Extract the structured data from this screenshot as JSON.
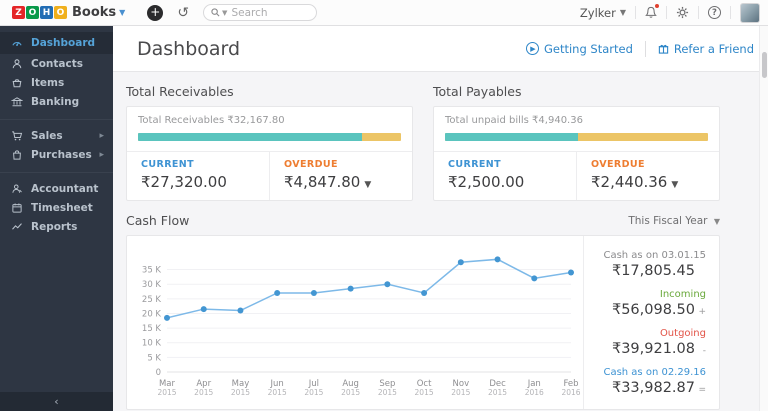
{
  "topbar": {
    "logo_letters": [
      {
        "ch": "Z",
        "color": "#e42527"
      },
      {
        "ch": "O",
        "color": "#089949"
      },
      {
        "ch": "H",
        "color": "#226db4"
      },
      {
        "ch": "O",
        "color": "#f0b01d"
      }
    ],
    "product": "Books",
    "plus_label": "+",
    "history_glyph": "↺",
    "search_placeholder": "Search",
    "org_name": "Zylker"
  },
  "sidebar": {
    "items": [
      {
        "label": "Dashboard"
      },
      {
        "label": "Contacts"
      },
      {
        "label": "Items"
      },
      {
        "label": "Banking"
      },
      {
        "label": "Sales"
      },
      {
        "label": "Purchases"
      },
      {
        "label": "Accountant"
      },
      {
        "label": "Timesheet"
      },
      {
        "label": "Reports"
      }
    ],
    "collapse_glyph": "‹"
  },
  "header": {
    "title": "Dashboard",
    "getting_started": "Getting Started",
    "refer_friend": "Refer a Friend"
  },
  "receivables": {
    "section_title": "Total Receivables",
    "summary": "Total Receivables ₹32,167.80",
    "current_label": "CURRENT",
    "current_value": "₹27,320.00",
    "overdue_label": "OVERDUE",
    "overdue_value": "₹4,847.80",
    "current_pct": 85
  },
  "payables": {
    "section_title": "Total Payables",
    "summary": "Total unpaid bills ₹4,940.36",
    "current_label": "CURRENT",
    "current_value": "₹2,500.00",
    "overdue_label": "OVERDUE",
    "overdue_value": "₹2,440.36",
    "current_pct": 50.6
  },
  "cashflow": {
    "section_title": "Cash Flow",
    "period": "This Fiscal Year",
    "rows": [
      {
        "label": "Cash as on 03.01.15",
        "value": "₹17,805.45",
        "sign": "",
        "color": "#8b8b8d"
      },
      {
        "label": "Incoming",
        "value": "₹56,098.50",
        "sign": "+",
        "color": "#6aa93c"
      },
      {
        "label": "Outgoing",
        "value": "₹39,921.08",
        "sign": "-",
        "color": "#e25347"
      },
      {
        "label": "Cash as on 02.29.16",
        "value": "₹33,982.87",
        "sign": "=",
        "color": "#3e93d3"
      }
    ]
  },
  "colors": {
    "teal": "#5ac4be",
    "yellow": "#ecc566",
    "accent_blue": "#2e86c8"
  },
  "chart_data": {
    "type": "line",
    "title": "Cash Flow",
    "x_labels": [
      "Mar 2015",
      "Apr 2015",
      "May 2015",
      "Jun 2015",
      "Jul 2015",
      "Aug 2015",
      "Sep 2015",
      "Oct 2015",
      "Nov 2015",
      "Dec 2015",
      "Jan 2016",
      "Feb 2016"
    ],
    "values": [
      18500,
      21500,
      21000,
      27000,
      27000,
      28500,
      30000,
      27000,
      37500,
      38500,
      32000,
      34000
    ],
    "ytick_values": [
      0,
      5000,
      10000,
      15000,
      20000,
      25000,
      30000,
      35000
    ],
    "ytick_labels": [
      "0",
      "5 K",
      "10 K",
      "15 K",
      "20 K",
      "25 K",
      "30 K",
      "35 K"
    ],
    "ylim": [
      0,
      41000
    ],
    "grid": true,
    "legend_position": "none",
    "line_color": "#7db9e8",
    "point_color": "#4396d2"
  }
}
